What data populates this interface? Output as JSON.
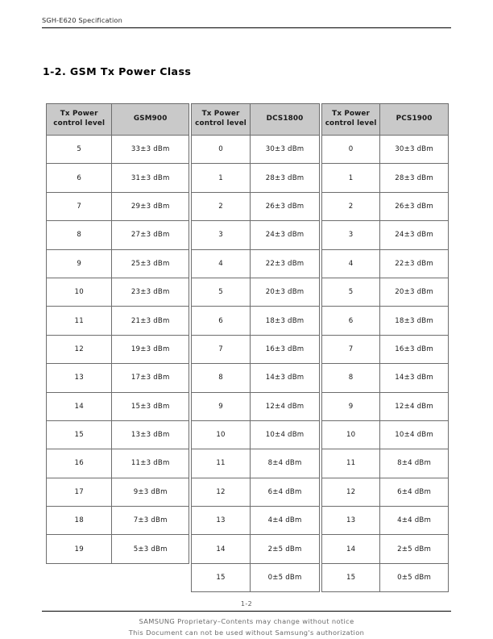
{
  "header": {
    "document_title": "SGH-E620 Specification"
  },
  "section": {
    "title": "1-2. GSM Tx Power Class"
  },
  "tables": [
    {
      "id": "gsm900",
      "headers": {
        "level_line1": "Tx Power",
        "level_line2": "control level",
        "band": "GSM900"
      },
      "rows": [
        {
          "level": "5",
          "value": "33±3 dBm"
        },
        {
          "level": "6",
          "value": "31±3 dBm"
        },
        {
          "level": "7",
          "value": "29±3 dBm"
        },
        {
          "level": "8",
          "value": "27±3 dBm"
        },
        {
          "level": "9",
          "value": "25±3 dBm"
        },
        {
          "level": "10",
          "value": "23±3 dBm"
        },
        {
          "level": "11",
          "value": "21±3 dBm"
        },
        {
          "level": "12",
          "value": "19±3 dBm"
        },
        {
          "level": "13",
          "value": "17±3 dBm"
        },
        {
          "level": "14",
          "value": "15±3 dBm"
        },
        {
          "level": "15",
          "value": "13±3 dBm"
        },
        {
          "level": "16",
          "value": "11±3 dBm"
        },
        {
          "level": "17",
          "value": "9±3 dBm"
        },
        {
          "level": "18",
          "value": "7±3 dBm"
        },
        {
          "level": "19",
          "value": "5±3 dBm"
        }
      ]
    },
    {
      "id": "dcs1800",
      "headers": {
        "level_line1": "Tx Power",
        "level_line2": "control level",
        "band": "DCS1800"
      },
      "rows": [
        {
          "level": "0",
          "value": "30±3 dBm"
        },
        {
          "level": "1",
          "value": "28±3 dBm"
        },
        {
          "level": "2",
          "value": "26±3 dBm"
        },
        {
          "level": "3",
          "value": "24±3 dBm"
        },
        {
          "level": "4",
          "value": "22±3 dBm"
        },
        {
          "level": "5",
          "value": "20±3 dBm"
        },
        {
          "level": "6",
          "value": "18±3 dBm"
        },
        {
          "level": "7",
          "value": "16±3 dBm"
        },
        {
          "level": "8",
          "value": "14±3 dBm"
        },
        {
          "level": "9",
          "value": "12±4 dBm"
        },
        {
          "level": "10",
          "value": "10±4 dBm"
        },
        {
          "level": "11",
          "value": "8±4 dBm"
        },
        {
          "level": "12",
          "value": "6±4 dBm"
        },
        {
          "level": "13",
          "value": "4±4 dBm"
        },
        {
          "level": "14",
          "value": "2±5 dBm"
        },
        {
          "level": "15",
          "value": "0±5 dBm"
        }
      ]
    },
    {
      "id": "pcs1900",
      "headers": {
        "level_line1": "Tx Power",
        "level_line2": "control level",
        "band": "PCS1900"
      },
      "rows": [
        {
          "level": "0",
          "value": "30±3 dBm"
        },
        {
          "level": "1",
          "value": "28±3 dBm"
        },
        {
          "level": "2",
          "value": "26±3 dBm"
        },
        {
          "level": "3",
          "value": "24±3 dBm"
        },
        {
          "level": "4",
          "value": "22±3 dBm"
        },
        {
          "level": "5",
          "value": "20±3 dBm"
        },
        {
          "level": "6",
          "value": "18±3 dBm"
        },
        {
          "level": "7",
          "value": "16±3 dBm"
        },
        {
          "level": "8",
          "value": "14±3 dBm"
        },
        {
          "level": "9",
          "value": "12±4 dBm"
        },
        {
          "level": "10",
          "value": "10±4 dBm"
        },
        {
          "level": "11",
          "value": "8±4 dBm"
        },
        {
          "level": "12",
          "value": "6±4 dBm"
        },
        {
          "level": "13",
          "value": "4±4 dBm"
        },
        {
          "level": "14",
          "value": "2±5 dBm"
        },
        {
          "level": "15",
          "value": "0±5 dBm"
        }
      ]
    }
  ],
  "page_number": "1-2",
  "footer": {
    "line1": "SAMSUNG Proprietary–Contents may change without notice",
    "line2": "This Document can not be used without Samsung's authorization"
  },
  "colors": {
    "header_fill": "#c9c9c9",
    "border": "#6d6d6d",
    "rule": "#000000",
    "footer_text": "#6b6b6b"
  }
}
